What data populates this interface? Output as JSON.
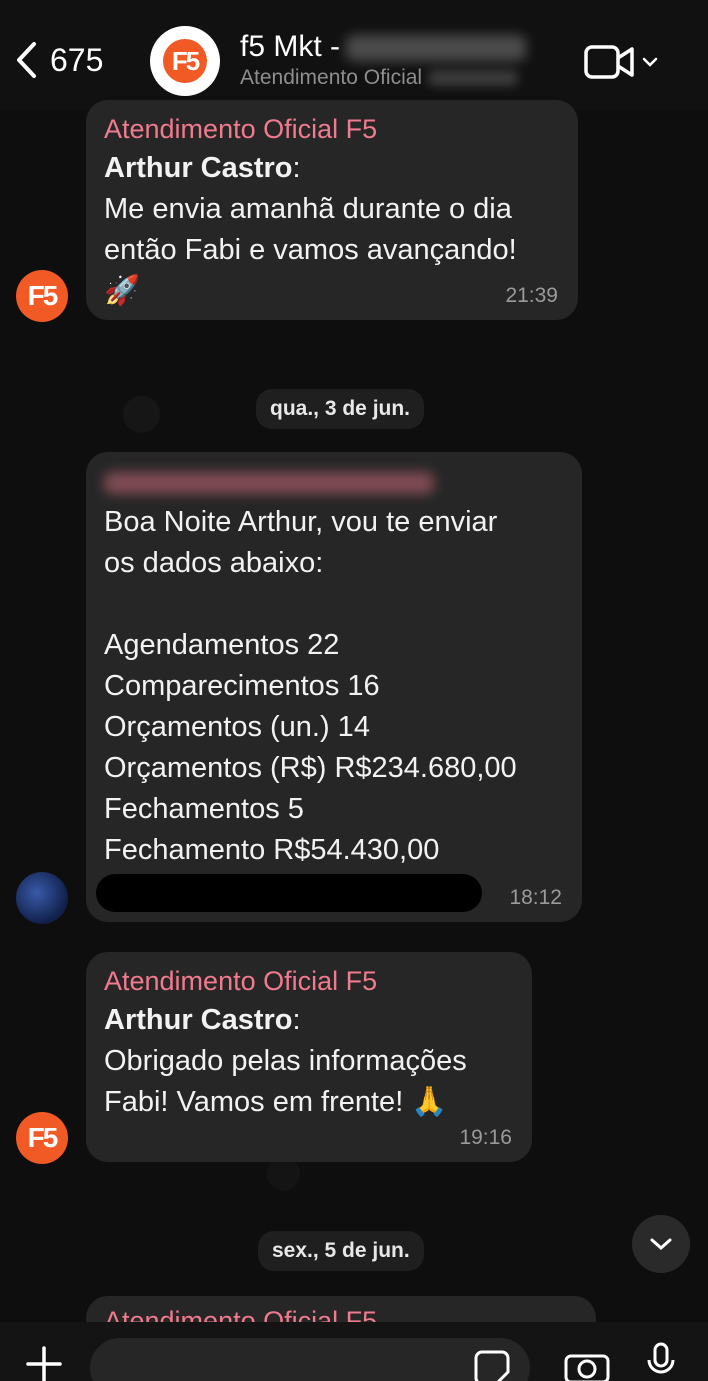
{
  "header": {
    "back_count": "675",
    "title": "f5 Mkt -",
    "subtitle": "Atendimento Oficial"
  },
  "logo_text": "F5",
  "messages": [
    {
      "sender": "Atendimento Oficial F5",
      "author": "Arthur Castro",
      "author_suffix": ":",
      "text": "Me envia amanhã durante o dia\nentão Fabi e vamos avançando!\n🚀",
      "time": "21:39"
    },
    {
      "text": "Boa Noite Arthur, vou te enviar\nos dados abaixo:\n\nAgendamentos 22\nComparecimentos 16\nOrçamentos (un.) 14\nOrçamentos (R$) R$234.680,00\nFechamentos 5\nFechamento R$54.430,00",
      "time": "18:12"
    },
    {
      "sender": "Atendimento Oficial F5",
      "author": "Arthur Castro",
      "author_suffix": ":",
      "text": "Obrigado pelas informações\nFabi! Vamos em frente! 🙏",
      "time": "19:16"
    }
  ],
  "dates": {
    "first": "qua., 3 de jun.",
    "second": "sex., 5 de jun."
  },
  "partial_sender": "Atendimento Oficial F5",
  "colors": {
    "brand_orange": "#f15a24",
    "sender_pink": "#f07a8e",
    "bubble": "#262626"
  }
}
